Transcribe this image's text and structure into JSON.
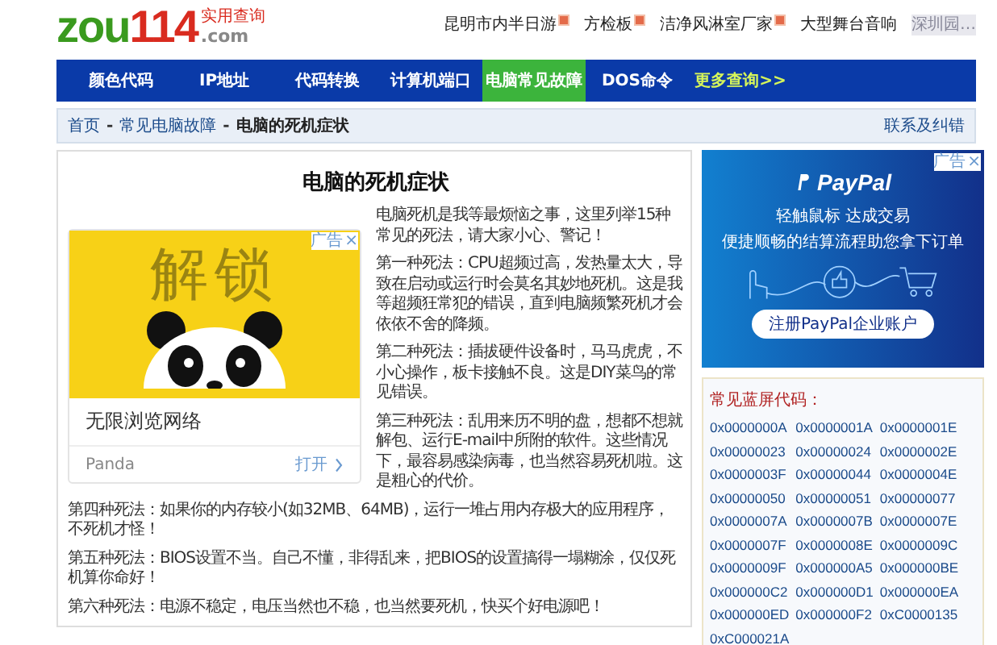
{
  "header": {
    "logo": {
      "letters": "zou",
      "number": "114",
      "tagline": "实用查询",
      "domain": ".com"
    },
    "links": [
      {
        "label": "昆明市内半日游",
        "badge": true
      },
      {
        "label": "方检板",
        "badge": true
      },
      {
        "label": "洁净风淋室厂家",
        "badge": true
      },
      {
        "label": "大型舞台音响",
        "badge": false
      },
      {
        "label": "深圳园…",
        "badge": false
      }
    ]
  },
  "nav": [
    {
      "label": "颜色代码",
      "selected": false,
      "kind": "item"
    },
    {
      "label": "IP地址",
      "selected": false,
      "kind": "item"
    },
    {
      "label": "代码转换",
      "selected": false,
      "kind": "item"
    },
    {
      "label": "计算机端口",
      "selected": false,
      "kind": "item"
    },
    {
      "label": "电脑常见故障",
      "selected": true,
      "kind": "item"
    },
    {
      "label": "DOS命令",
      "selected": false,
      "kind": "item"
    },
    {
      "label": "更多查询>>",
      "selected": false,
      "kind": "more"
    }
  ],
  "breadcrumb": {
    "items": [
      {
        "label": "首页",
        "current": false
      },
      {
        "label": "常见电脑故障",
        "current": false
      },
      {
        "label": "电脑的死机症状",
        "current": true
      }
    ],
    "separator": "-",
    "feedback_link": "联系及纠错"
  },
  "article": {
    "title": "电脑的死机症状",
    "ad": {
      "ad_label": "广告",
      "close": "×",
      "headline": "解锁",
      "caption": "无限浏览网络",
      "brand": "Panda",
      "action": "打开"
    },
    "side_paragraphs": [
      "电脑死机是我等最烦恼之事，这里列举15种常见的死法，请大家小心、警记！",
      "第一种死法：CPU超频过高，发热量太大，导致在启动或运行时会莫名其妙地死机。这是我等超频狂常犯的错误，直到电脑频繁死机才会依依不舍的降频。",
      "第二种死法：插拔硬件设备时，马马虎虎，不小心操作，板卡接触不良。这是DIY菜鸟的常见错误。",
      "第三种死法：乱用来历不明的盘，想都不想就解包、运行E-mail中所附的软件。这些情况下，最容易感染病毒，也当然容易死机啦。这是粗心的代价。"
    ],
    "paragraphs": [
      "第四种死法：如果你的内存较小(如32MB、64MB)，运行一堆占用内存极大的应用程序，不死机才怪！",
      "第五种死法：BIOS设置不当。自己不懂，非得乱来，把BIOS的设置搞得一塌糊涂，仅仅死机算你命好！",
      "第六种死法：电源不稳定，电压当然也不稳，也当然要死机，快买个好电源吧！"
    ]
  },
  "sidebar": {
    "ad": {
      "ad_label": "广告",
      "close": "×",
      "brand": "PayPal",
      "headline": "轻触鼠标 达成交易",
      "subline": "便捷顺畅的结算流程助您拿下订单",
      "button": "注册PayPal企业账户"
    },
    "codes": {
      "title": "常见蓝屏代码：",
      "items": [
        "0x0000000A",
        "0x0000001A",
        "0x0000001E",
        "0x00000023",
        "0x00000024",
        "0x0000002E",
        "0x0000003F",
        "0x00000044",
        "0x0000004E",
        "0x00000050",
        "0x00000051",
        "0x00000077",
        "0x0000007A",
        "0x0000007B",
        "0x0000007E",
        "0x0000007F",
        "0x0000008E",
        "0x0000009C",
        "0x0000009F",
        "0x000000A5",
        "0x000000BE",
        "0x000000C2",
        "0x000000D1",
        "0x000000EA",
        "0x000000ED",
        "0x000000F2",
        "0xC0000135",
        "0xC000021A"
      ]
    }
  }
}
